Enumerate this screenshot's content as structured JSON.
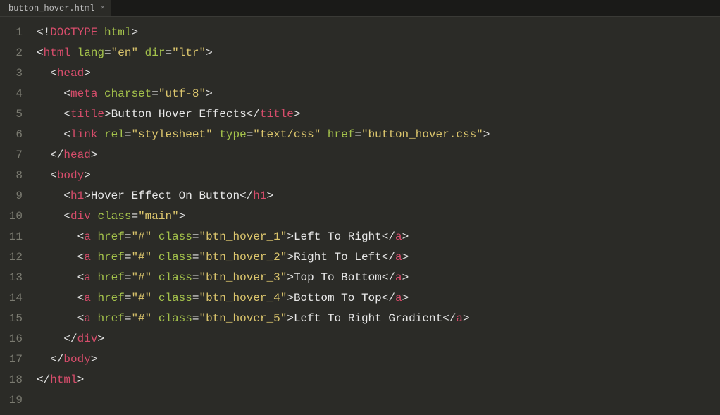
{
  "tab": {
    "filename": "button_hover.html",
    "close_glyph": "×"
  },
  "gutter": [
    "1",
    "2",
    "3",
    "4",
    "5",
    "6",
    "7",
    "8",
    "9",
    "10",
    "11",
    "12",
    "13",
    "14",
    "15",
    "16",
    "17",
    "18",
    "19"
  ],
  "code": {
    "lines": [
      [
        {
          "c": "p",
          "t": "<!"
        },
        {
          "c": "t",
          "t": "DOCTYPE"
        },
        {
          "c": "p",
          "t": " "
        },
        {
          "c": "a",
          "t": "html"
        },
        {
          "c": "p",
          "t": ">"
        }
      ],
      [
        {
          "c": "p",
          "t": "<"
        },
        {
          "c": "t",
          "t": "html"
        },
        {
          "c": "p",
          "t": " "
        },
        {
          "c": "a",
          "t": "lang"
        },
        {
          "c": "p",
          "t": "="
        },
        {
          "c": "s",
          "t": "\"en\""
        },
        {
          "c": "p",
          "t": " "
        },
        {
          "c": "a",
          "t": "dir"
        },
        {
          "c": "p",
          "t": "="
        },
        {
          "c": "s",
          "t": "\"ltr\""
        },
        {
          "c": "p",
          "t": ">"
        }
      ],
      [
        {
          "c": "p",
          "t": "  <"
        },
        {
          "c": "t",
          "t": "head"
        },
        {
          "c": "p",
          "t": ">"
        }
      ],
      [
        {
          "c": "p",
          "t": "    <"
        },
        {
          "c": "t",
          "t": "meta"
        },
        {
          "c": "p",
          "t": " "
        },
        {
          "c": "a",
          "t": "charset"
        },
        {
          "c": "p",
          "t": "="
        },
        {
          "c": "s",
          "t": "\"utf-8\""
        },
        {
          "c": "p",
          "t": ">"
        }
      ],
      [
        {
          "c": "p",
          "t": "    <"
        },
        {
          "c": "t",
          "t": "title"
        },
        {
          "c": "p",
          "t": ">"
        },
        {
          "c": "tx",
          "t": "Button Hover Effects"
        },
        {
          "c": "p",
          "t": "</"
        },
        {
          "c": "t",
          "t": "title"
        },
        {
          "c": "p",
          "t": ">"
        }
      ],
      [
        {
          "c": "p",
          "t": "    <"
        },
        {
          "c": "t",
          "t": "link"
        },
        {
          "c": "p",
          "t": " "
        },
        {
          "c": "a",
          "t": "rel"
        },
        {
          "c": "p",
          "t": "="
        },
        {
          "c": "s",
          "t": "\"stylesheet\""
        },
        {
          "c": "p",
          "t": " "
        },
        {
          "c": "a",
          "t": "type"
        },
        {
          "c": "p",
          "t": "="
        },
        {
          "c": "s",
          "t": "\"text/css\""
        },
        {
          "c": "p",
          "t": " "
        },
        {
          "c": "a",
          "t": "href"
        },
        {
          "c": "p",
          "t": "="
        },
        {
          "c": "s",
          "t": "\"button_hover.css\""
        },
        {
          "c": "p",
          "t": ">"
        }
      ],
      [
        {
          "c": "p",
          "t": "  </"
        },
        {
          "c": "t",
          "t": "head"
        },
        {
          "c": "p",
          "t": ">"
        }
      ],
      [
        {
          "c": "p",
          "t": "  <"
        },
        {
          "c": "t",
          "t": "body"
        },
        {
          "c": "p",
          "t": ">"
        }
      ],
      [
        {
          "c": "p",
          "t": "    <"
        },
        {
          "c": "t",
          "t": "h1"
        },
        {
          "c": "p",
          "t": ">"
        },
        {
          "c": "tx",
          "t": "Hover Effect On Button"
        },
        {
          "c": "p",
          "t": "</"
        },
        {
          "c": "t",
          "t": "h1"
        },
        {
          "c": "p",
          "t": ">"
        }
      ],
      [
        {
          "c": "p",
          "t": "    <"
        },
        {
          "c": "t",
          "t": "div"
        },
        {
          "c": "p",
          "t": " "
        },
        {
          "c": "a",
          "t": "class"
        },
        {
          "c": "p",
          "t": "="
        },
        {
          "c": "s",
          "t": "\"main\""
        },
        {
          "c": "p",
          "t": ">"
        }
      ],
      [
        {
          "c": "p",
          "t": "      <"
        },
        {
          "c": "t",
          "t": "a"
        },
        {
          "c": "p",
          "t": " "
        },
        {
          "c": "a",
          "t": "href"
        },
        {
          "c": "p",
          "t": "="
        },
        {
          "c": "s",
          "t": "\"#\""
        },
        {
          "c": "p",
          "t": " "
        },
        {
          "c": "a",
          "t": "class"
        },
        {
          "c": "p",
          "t": "="
        },
        {
          "c": "s",
          "t": "\"btn_hover_1\""
        },
        {
          "c": "p",
          "t": ">"
        },
        {
          "c": "tx",
          "t": "Left To Right"
        },
        {
          "c": "p",
          "t": "</"
        },
        {
          "c": "t",
          "t": "a"
        },
        {
          "c": "p",
          "t": ">"
        }
      ],
      [
        {
          "c": "p",
          "t": "      <"
        },
        {
          "c": "t",
          "t": "a"
        },
        {
          "c": "p",
          "t": " "
        },
        {
          "c": "a",
          "t": "href"
        },
        {
          "c": "p",
          "t": "="
        },
        {
          "c": "s",
          "t": "\"#\""
        },
        {
          "c": "p",
          "t": " "
        },
        {
          "c": "a",
          "t": "class"
        },
        {
          "c": "p",
          "t": "="
        },
        {
          "c": "s",
          "t": "\"btn_hover_2\""
        },
        {
          "c": "p",
          "t": ">"
        },
        {
          "c": "tx",
          "t": "Right To Left"
        },
        {
          "c": "p",
          "t": "</"
        },
        {
          "c": "t",
          "t": "a"
        },
        {
          "c": "p",
          "t": ">"
        }
      ],
      [
        {
          "c": "p",
          "t": "      <"
        },
        {
          "c": "t",
          "t": "a"
        },
        {
          "c": "p",
          "t": " "
        },
        {
          "c": "a",
          "t": "href"
        },
        {
          "c": "p",
          "t": "="
        },
        {
          "c": "s",
          "t": "\"#\""
        },
        {
          "c": "p",
          "t": " "
        },
        {
          "c": "a",
          "t": "class"
        },
        {
          "c": "p",
          "t": "="
        },
        {
          "c": "s",
          "t": "\"btn_hover_3\""
        },
        {
          "c": "p",
          "t": ">"
        },
        {
          "c": "tx",
          "t": "Top To Bottom"
        },
        {
          "c": "p",
          "t": "</"
        },
        {
          "c": "t",
          "t": "a"
        },
        {
          "c": "p",
          "t": ">"
        }
      ],
      [
        {
          "c": "p",
          "t": "      <"
        },
        {
          "c": "t",
          "t": "a"
        },
        {
          "c": "p",
          "t": " "
        },
        {
          "c": "a",
          "t": "href"
        },
        {
          "c": "p",
          "t": "="
        },
        {
          "c": "s",
          "t": "\"#\""
        },
        {
          "c": "p",
          "t": " "
        },
        {
          "c": "a",
          "t": "class"
        },
        {
          "c": "p",
          "t": "="
        },
        {
          "c": "s",
          "t": "\"btn_hover_4\""
        },
        {
          "c": "p",
          "t": ">"
        },
        {
          "c": "tx",
          "t": "Bottom To Top"
        },
        {
          "c": "p",
          "t": "</"
        },
        {
          "c": "t",
          "t": "a"
        },
        {
          "c": "p",
          "t": ">"
        }
      ],
      [
        {
          "c": "p",
          "t": "      <"
        },
        {
          "c": "t",
          "t": "a"
        },
        {
          "c": "p",
          "t": " "
        },
        {
          "c": "a",
          "t": "href"
        },
        {
          "c": "p",
          "t": "="
        },
        {
          "c": "s",
          "t": "\"#\""
        },
        {
          "c": "p",
          "t": " "
        },
        {
          "c": "a",
          "t": "class"
        },
        {
          "c": "p",
          "t": "="
        },
        {
          "c": "s",
          "t": "\"btn_hover_5\""
        },
        {
          "c": "p",
          "t": ">"
        },
        {
          "c": "tx",
          "t": "Left To Right Gradient"
        },
        {
          "c": "p",
          "t": "</"
        },
        {
          "c": "t",
          "t": "a"
        },
        {
          "c": "p",
          "t": ">"
        }
      ],
      [
        {
          "c": "p",
          "t": "    </"
        },
        {
          "c": "t",
          "t": "div"
        },
        {
          "c": "p",
          "t": ">"
        }
      ],
      [
        {
          "c": "p",
          "t": "  </"
        },
        {
          "c": "t",
          "t": "body"
        },
        {
          "c": "p",
          "t": ">"
        }
      ],
      [
        {
          "c": "p",
          "t": "</"
        },
        {
          "c": "t",
          "t": "html"
        },
        {
          "c": "p",
          "t": ">"
        }
      ],
      []
    ]
  }
}
